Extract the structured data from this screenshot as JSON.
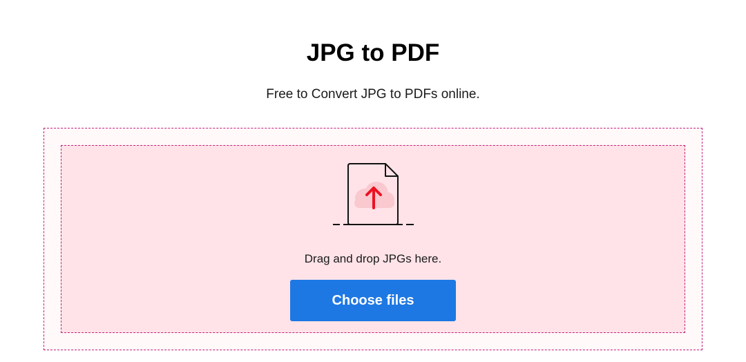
{
  "header": {
    "title": "JPG to PDF",
    "subtitle": "Free to Convert JPG to PDFs online."
  },
  "dropzone": {
    "icon": "file-upload-icon",
    "instruction": "Drag and drop JPGs here.",
    "button_label": "Choose files"
  },
  "colors": {
    "accent": "#1e78e3",
    "dropzone_border": "#c21e7a",
    "dropzone_fill": "#ffe3e8",
    "arrow": "#ee1122",
    "cloud": "#f9c9cf"
  }
}
